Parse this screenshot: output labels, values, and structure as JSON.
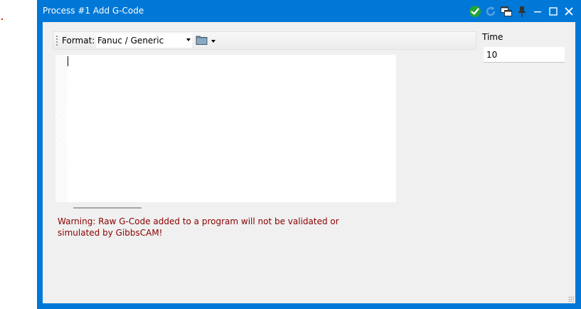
{
  "window": {
    "title": "Process #1 Add G-Code",
    "colors": {
      "title_bar": "#0078d7",
      "client_bg": "#f0f0f0",
      "warning_text": "#8b0000"
    },
    "title_icons": [
      "check-icon",
      "refresh-icon",
      "windows-icon",
      "pin-icon",
      "minimize-icon",
      "maximize-icon",
      "close-icon"
    ]
  },
  "toolbar": {
    "format_label": "Format:",
    "format_value": "Fanuc / Generic",
    "folder_icon": "folder-icon"
  },
  "time": {
    "label": "Time",
    "value": "10"
  },
  "editor": {
    "content": ""
  },
  "warning": {
    "text": "Warning: Raw G-Code added to a program will not be validated or simulated by GibbsCAM!"
  }
}
